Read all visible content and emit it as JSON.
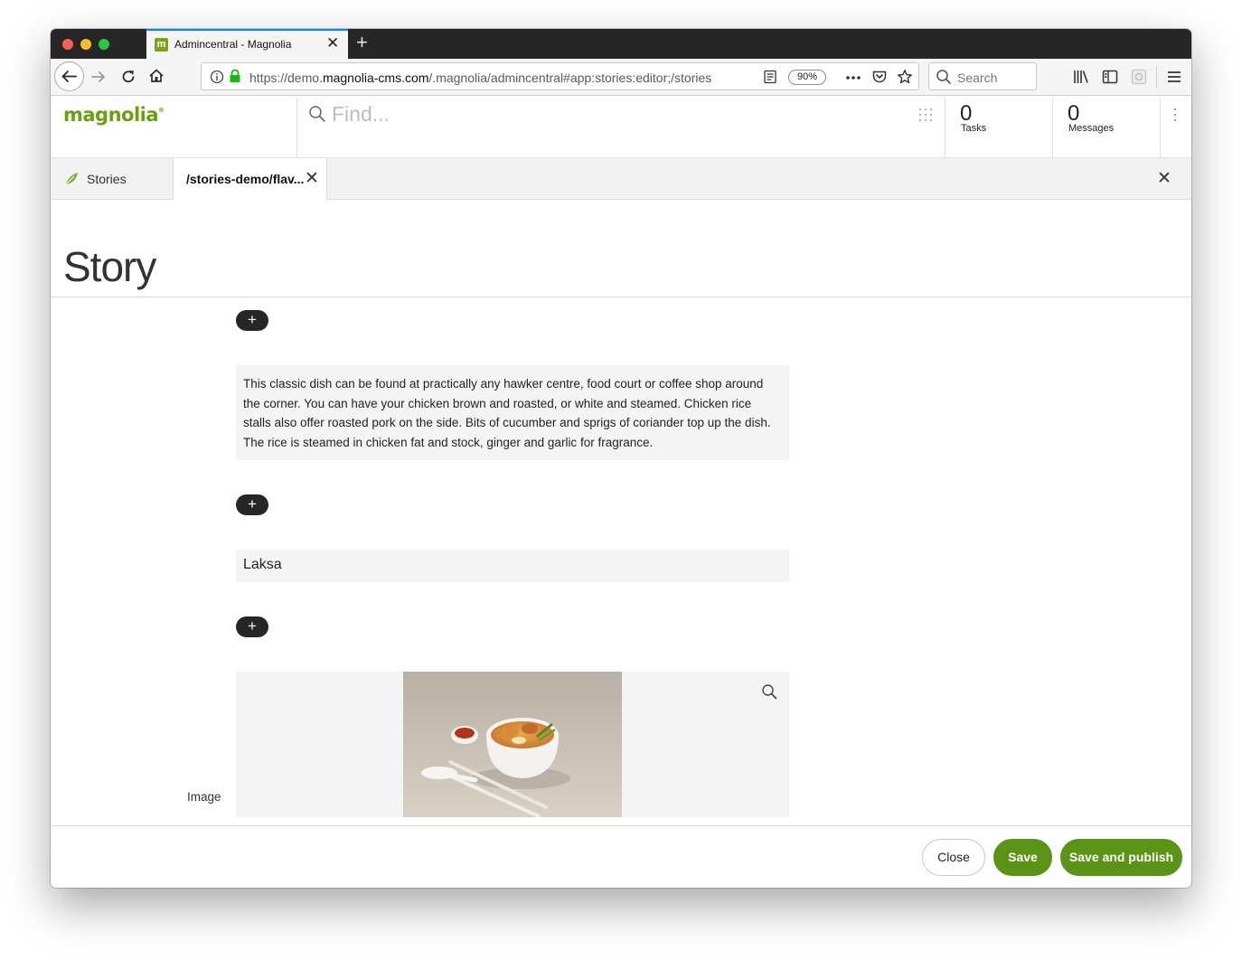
{
  "browser": {
    "tab_title": "Admincentral - Magnolia",
    "favicon_letter": "m",
    "new_tab_glyph": "+",
    "close_glyph": "✕",
    "url_prefix": "https://demo.",
    "url_domain": "magnolia-cms.com",
    "url_path": "/.magnolia/admincentral#app:stories:editor;/stories",
    "zoom": "90%",
    "search_placeholder": "Search",
    "icons": [
      "back-icon",
      "forward-icon",
      "reload-icon",
      "home-icon",
      "info-icon",
      "lock-icon",
      "reader-icon",
      "more-icon",
      "pocket-icon",
      "star-icon",
      "search-icon",
      "library-icon",
      "sidebar-icon",
      "extension-icon",
      "menu-icon"
    ]
  },
  "header": {
    "logo": "magnolia",
    "logo_mark": "®",
    "find_placeholder": "Find...",
    "tasks_count": "0",
    "tasks_label": "Tasks",
    "messages_count": "0",
    "messages_label": "Messages"
  },
  "app_tabs": {
    "stories_label": "Stories",
    "editor_label": "/stories-demo/flav...",
    "close_glyph": "✕"
  },
  "editor": {
    "title": "Story",
    "add_glyph": "+",
    "text_block": "This classic dish can be found at practically any hawker centre, food court or coffee shop around the corner. You can have your chicken brown and roasted, or white and steamed. Chicken rice stalls also offer roasted pork on the side. Bits of cucumber and sprigs of coriander top up the dish. The rice is steamed in chicken fat and stock, ginger and garlic for fragrance.",
    "heading_block": "Laksa",
    "image_label": "Image"
  },
  "footer": {
    "close_label": "Close",
    "save_label": "Save",
    "publish_label": "Save and publish"
  },
  "colors": {
    "brand_green": "#5b9316",
    "logo_green": "#6a9f12",
    "tabstrip_dark": "#262626",
    "tab_accent": "#0a84ff"
  }
}
